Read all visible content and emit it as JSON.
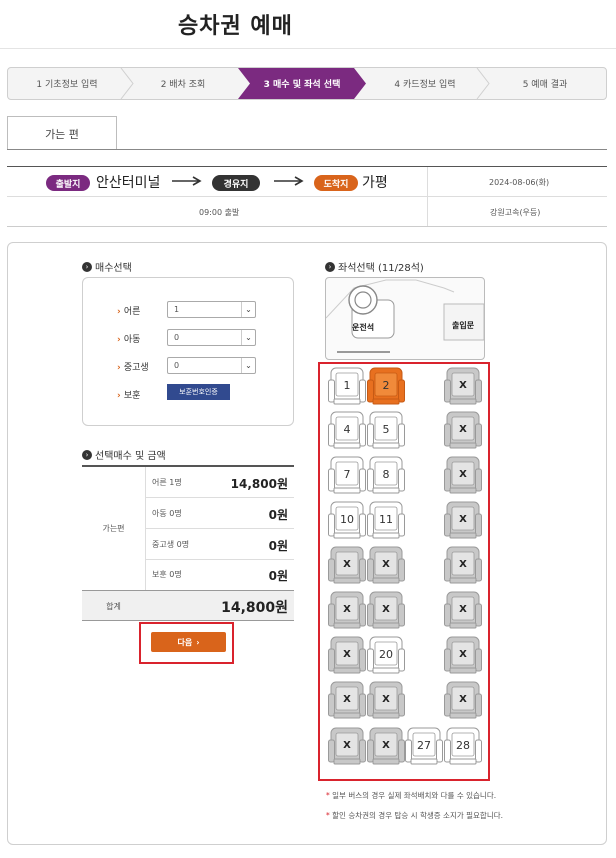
{
  "page_title": "승차권 예매",
  "steps": [
    {
      "label": "1 기초정보 입력",
      "active": false
    },
    {
      "label": "2 배차 조회",
      "active": false
    },
    {
      "label": "3 매수 및 좌석 선택",
      "active": true
    },
    {
      "label": "4 카드정보 입력",
      "active": false
    },
    {
      "label": "5 예매 결과",
      "active": false
    }
  ],
  "tab": {
    "label": "가는 편"
  },
  "route": {
    "departure_badge": "출발지",
    "departure": "안산터미널",
    "via_badge": "경유지",
    "arrival_badge": "도착지",
    "arrival": "가평",
    "date": "2024-08-06(화)",
    "time": "09:00 출발",
    "company": "강원고속(우등)"
  },
  "passenger": {
    "title": "매수선택",
    "rows": [
      {
        "label": "어른",
        "value": "1"
      },
      {
        "label": "아동",
        "value": "0"
      },
      {
        "label": "중고생",
        "value": "0"
      }
    ],
    "discount_label": "보훈",
    "discount_button": "보훈번호인증"
  },
  "fare": {
    "title": "선택매수 및 금액",
    "direction": "가는편",
    "items": [
      {
        "label": "어른 1명",
        "amount": "14,800원"
      },
      {
        "label": "아동 0명",
        "amount": "0원"
      },
      {
        "label": "중고생 0명",
        "amount": "0원"
      },
      {
        "label": "보훈 0명",
        "amount": "0원"
      }
    ],
    "total_label": "합계",
    "total_amount": "14,800원"
  },
  "next_button": "다음",
  "seat_map": {
    "title": "좌석선택 (11/28석)",
    "driver": "운전석",
    "door": "출입문",
    "seats": [
      {
        "label": "1",
        "state": "available"
      },
      {
        "label": "2",
        "state": "selected"
      },
      {
        "label": "X",
        "state": "taken"
      },
      {
        "label": "4",
        "state": "available"
      },
      {
        "label": "5",
        "state": "available"
      },
      {
        "label": "X",
        "state": "taken"
      },
      {
        "label": "7",
        "state": "available"
      },
      {
        "label": "8",
        "state": "available"
      },
      {
        "label": "X",
        "state": "taken"
      },
      {
        "label": "10",
        "state": "available"
      },
      {
        "label": "11",
        "state": "available"
      },
      {
        "label": "X",
        "state": "taken"
      },
      {
        "label": "X",
        "state": "taken"
      },
      {
        "label": "X",
        "state": "taken"
      },
      {
        "label": "X",
        "state": "taken"
      },
      {
        "label": "X",
        "state": "taken"
      },
      {
        "label": "X",
        "state": "taken"
      },
      {
        "label": "X",
        "state": "taken"
      },
      {
        "label": "X",
        "state": "taken"
      },
      {
        "label": "20",
        "state": "available"
      },
      {
        "label": "X",
        "state": "taken"
      },
      {
        "label": "X",
        "state": "taken"
      },
      {
        "label": "X",
        "state": "taken"
      },
      {
        "label": "X",
        "state": "taken"
      },
      {
        "label": "X",
        "state": "taken"
      },
      {
        "label": "X",
        "state": "taken"
      },
      {
        "label": "27",
        "state": "available"
      },
      {
        "label": "28",
        "state": "available"
      }
    ],
    "notes": [
      "일부 버스의 경우 실제 좌석배치와 다를 수 있습니다.",
      "할인 승차권의 경우 탑승 시 학생증 소지가 필요합니다."
    ]
  },
  "colors": {
    "step_active": "#7b2a80",
    "departure_badge": "#7b2a80",
    "via_badge": "#333333",
    "arrival_badge": "#d9641b",
    "selected_seat": "#e8701f",
    "next_button": "#d9641b",
    "highlight_outline": "#d9232d",
    "discount_button": "#314a8f"
  }
}
